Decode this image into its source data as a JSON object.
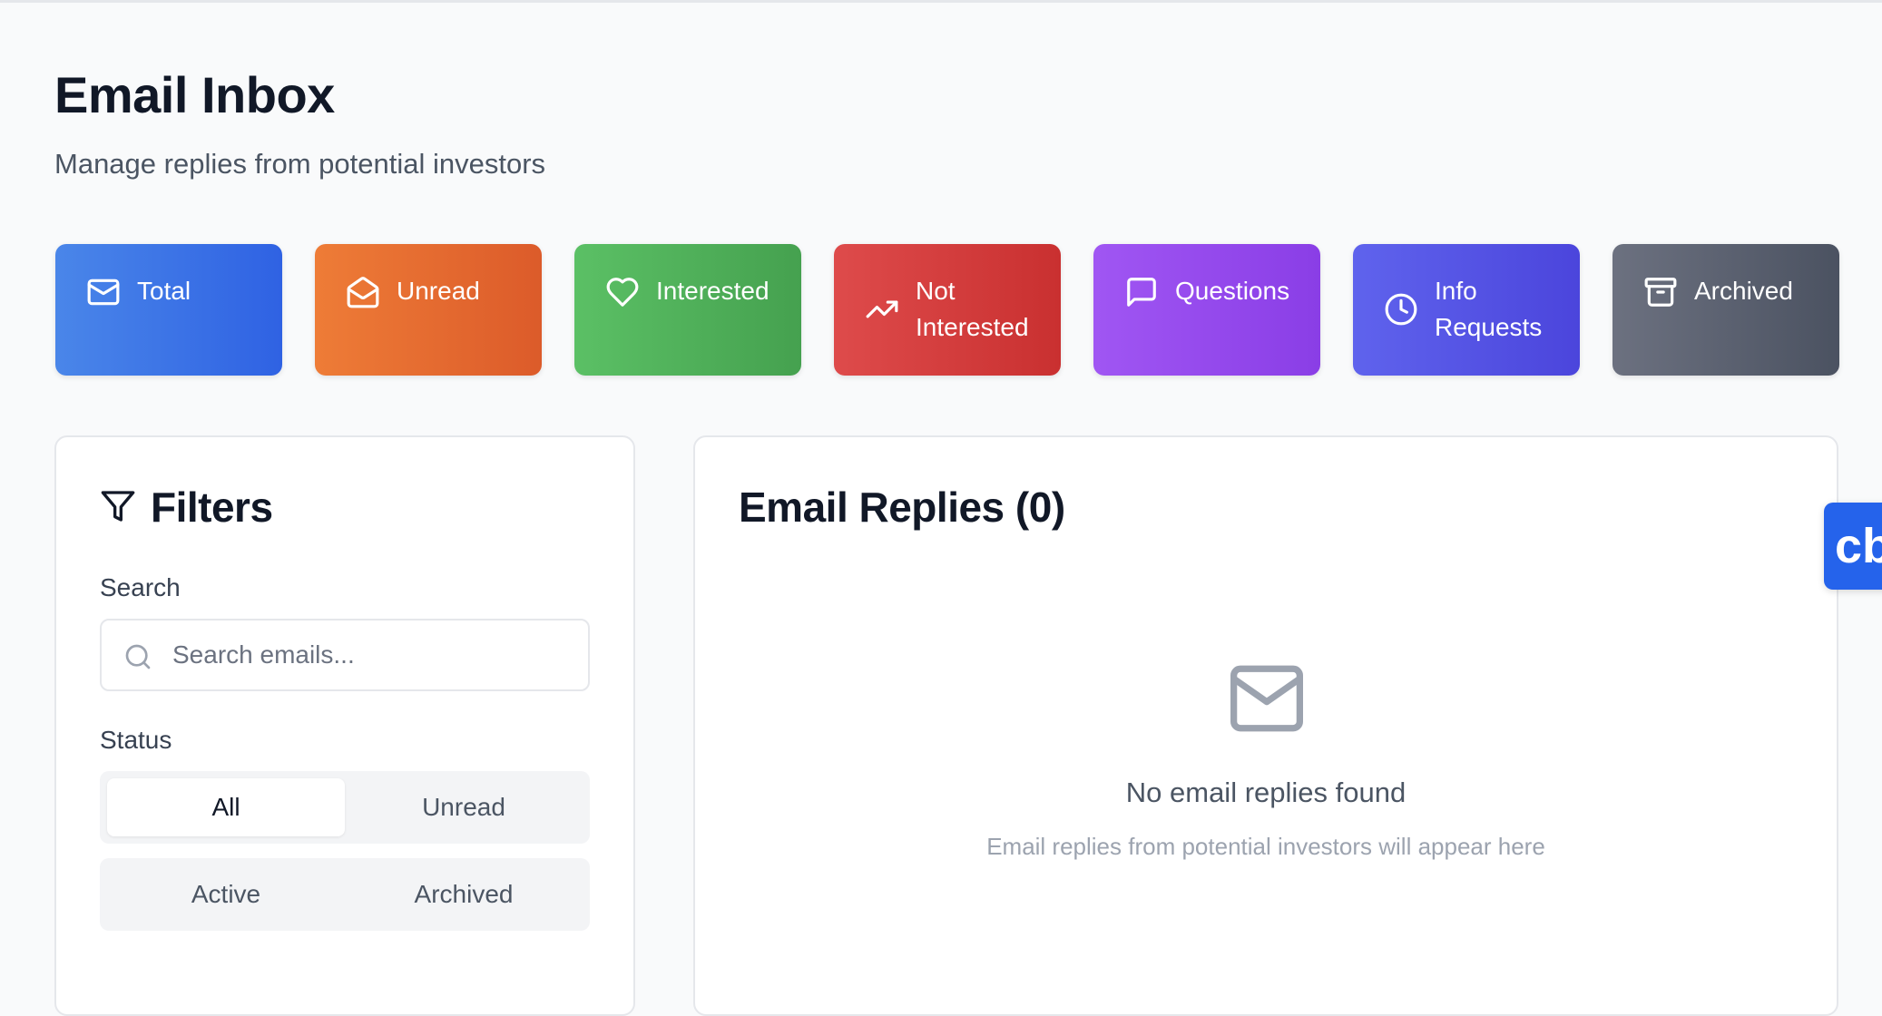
{
  "header": {
    "title": "Email Inbox",
    "subtitle": "Manage replies from potential investors"
  },
  "stats": [
    {
      "label": "Total",
      "icon": "mail-icon",
      "color": "#3b82f6"
    },
    {
      "label": "Unread",
      "icon": "mail-open-icon",
      "color": "#f97316"
    },
    {
      "label": "Interested",
      "icon": "heart-icon",
      "color": "#22c55e"
    },
    {
      "label": "Not Interested",
      "label_line1": "Not",
      "label_line2": "Interested",
      "icon": "trending-icon",
      "color": "#ef4444"
    },
    {
      "label": "Questions",
      "icon": "message-square-icon",
      "color": "#a855f7"
    },
    {
      "label": "Info Requests",
      "label_line1": "Info",
      "label_line2": "Requests",
      "icon": "clock-icon",
      "color": "#6366f1"
    },
    {
      "label": "Archived",
      "icon": "archive-icon",
      "color": "#6b7280"
    }
  ],
  "filters": {
    "title": "Filters",
    "search_label": "Search",
    "search_placeholder": "Search emails...",
    "search_value": "",
    "status_label": "Status",
    "status_options": [
      "All",
      "Unread",
      "Active",
      "Archived"
    ],
    "selected_status": "All"
  },
  "replies": {
    "title": "Email Replies (0)",
    "empty_title": "No email replies found",
    "empty_subtitle": "Email replies from potential investors will appear here"
  },
  "chat_widget": {
    "label": "cb",
    "color": "#2563eb"
  }
}
